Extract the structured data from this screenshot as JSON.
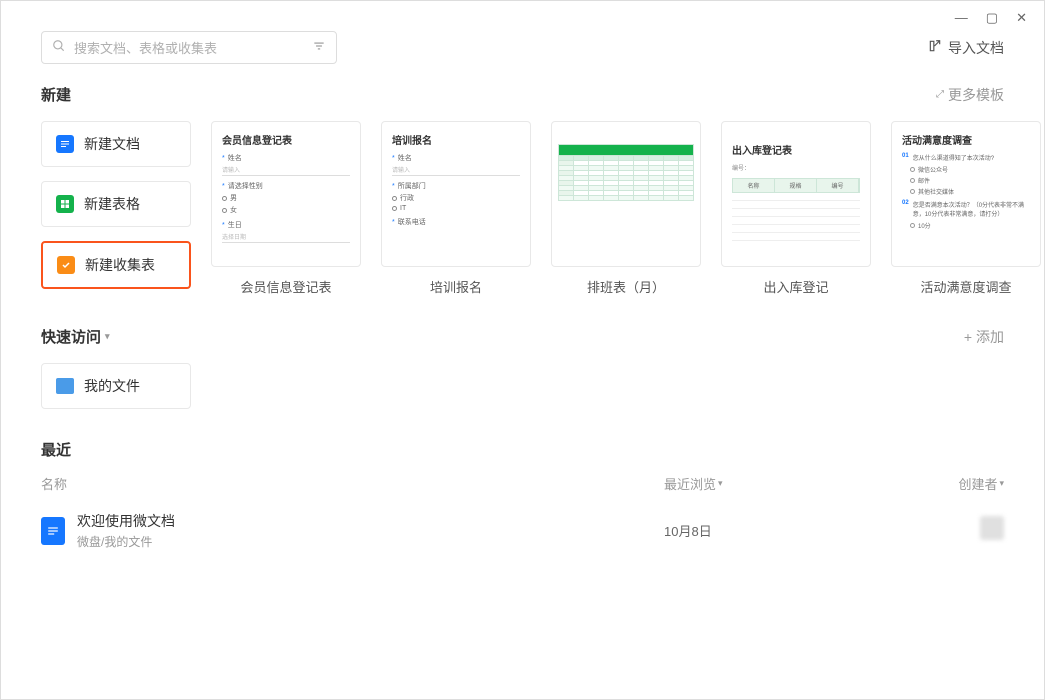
{
  "window": {
    "minimize": "—",
    "maximize": "▢",
    "close": "✕"
  },
  "search": {
    "placeholder": "搜索文档、表格或收集表"
  },
  "import_label": "导入文档",
  "sections": {
    "new": {
      "title": "新建",
      "more": "更多模板",
      "buttons": [
        {
          "label": "新建文档",
          "icon": "doc"
        },
        {
          "label": "新建表格",
          "icon": "sheet"
        },
        {
          "label": "新建收集表",
          "icon": "form"
        }
      ],
      "templates": [
        {
          "label": "会员信息登记表",
          "preview": {
            "title": "会员信息登记表",
            "fields": {
              "name": "姓名",
              "name_hint": "请输入",
              "gender": "请选择性别",
              "gender_m": "男",
              "gender_f": "女",
              "birth": "生日",
              "birth_hint": "选择日期"
            }
          }
        },
        {
          "label": "培训报名",
          "preview": {
            "title": "培训报名",
            "fields": {
              "name": "姓名",
              "name_hint": "请输入",
              "dept": "所属部门",
              "dept1": "行政",
              "dept2": "IT",
              "phone": "联系电话"
            }
          }
        },
        {
          "label": "排班表（月）",
          "preview": {
            "header": ""
          }
        },
        {
          "label": "出入库登记",
          "preview": {
            "title": "出入库登记表",
            "subtitle": "编号：",
            "cols": {
              "c1": "名称",
              "c2": "规格",
              "c3": "编号"
            }
          }
        },
        {
          "label": "活动满意度调查",
          "preview": {
            "title": "活动满意度调查",
            "q1": {
              "num": "01",
              "text": "您从什么渠道得知了本次活动?"
            },
            "q1_opts": {
              "o1": "微信公众号",
              "o2": "邮件",
              "o3": "其他社交媒体"
            },
            "q2": {
              "num": "02",
              "text": "您是否满意本次活动？（0分代表非常不满意，10分代表非常满意，请打分）"
            },
            "q2_opts": {
              "o1": "10分"
            }
          }
        }
      ]
    },
    "quick": {
      "title": "快速访问",
      "add": "添加",
      "my_files": "我的文件"
    },
    "recent": {
      "title": "最近",
      "cols": {
        "name": "名称",
        "browse": "最近浏览",
        "creator": "创建者"
      },
      "rows": [
        {
          "title": "欢迎使用微文档",
          "path": "微盘/我的文件",
          "date": "10月8日"
        }
      ]
    }
  }
}
